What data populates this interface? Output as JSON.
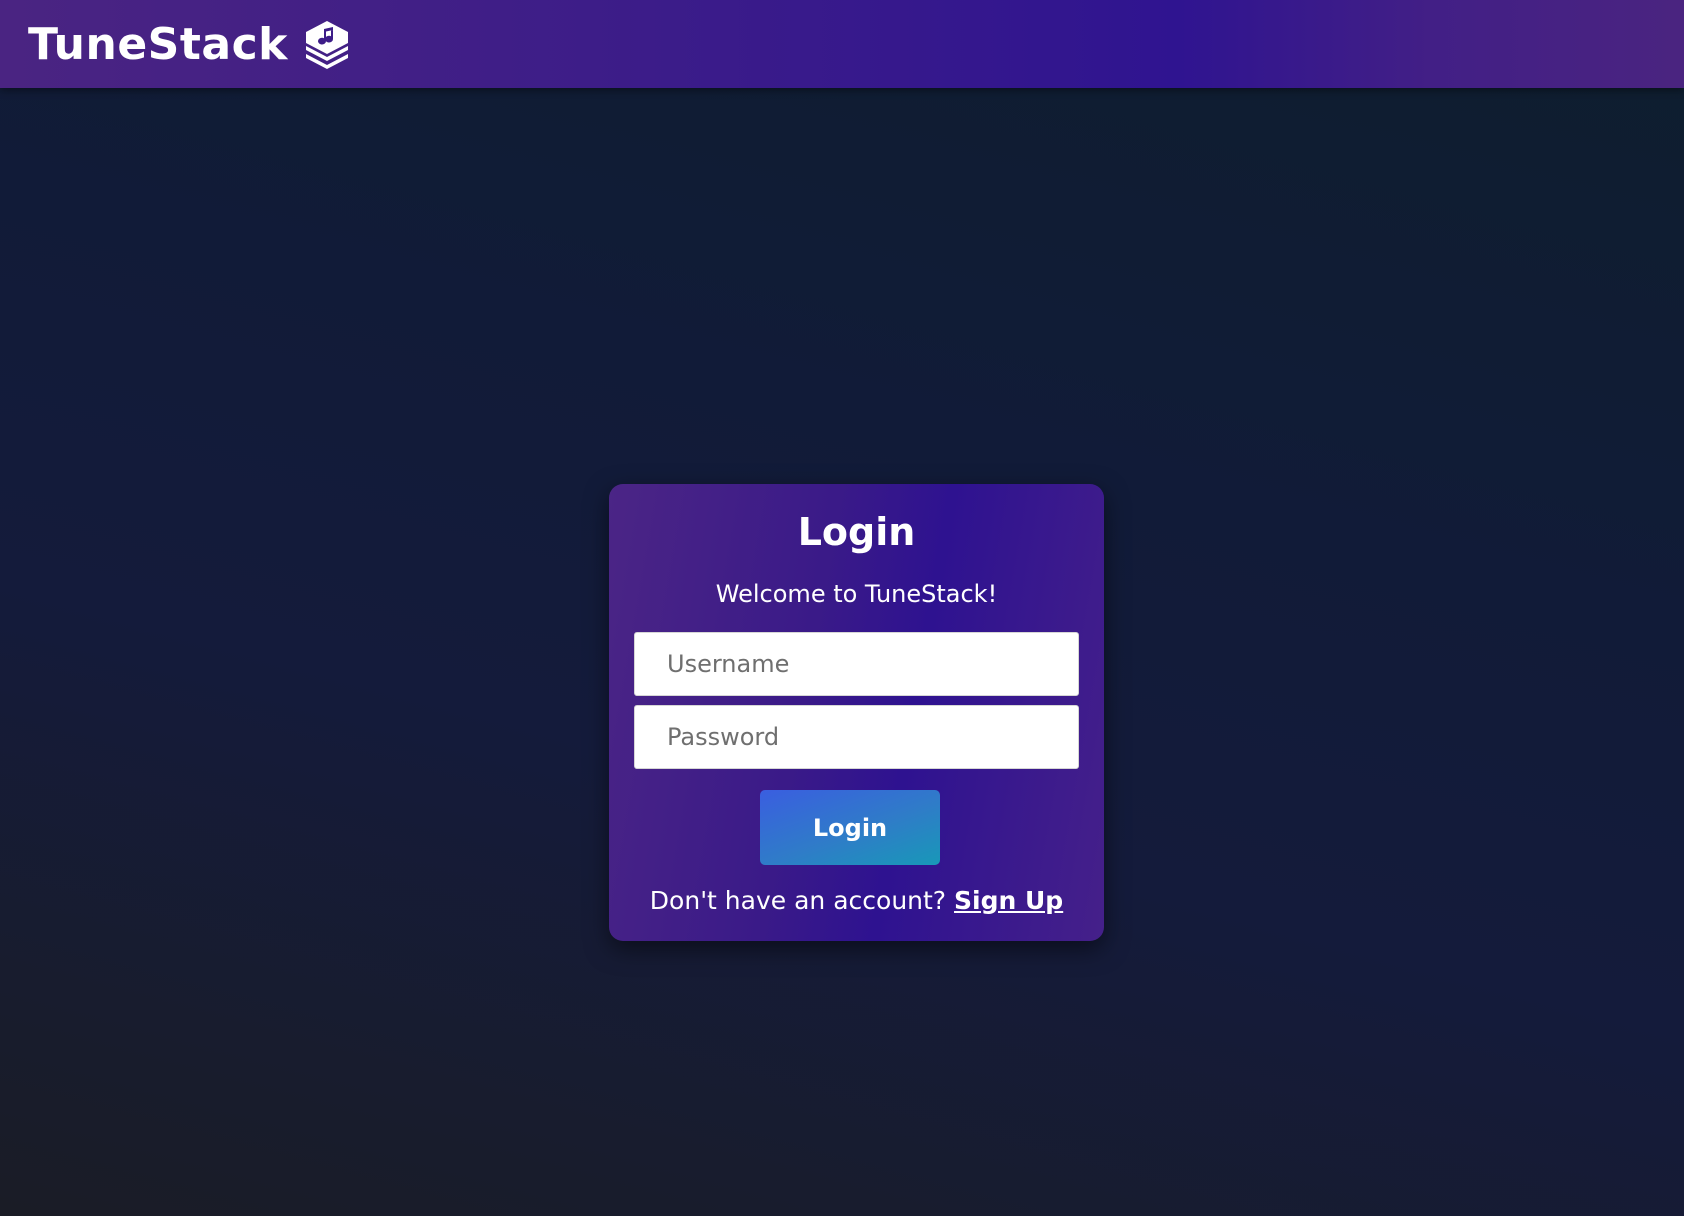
{
  "navbar": {
    "brand_title": "TuneStack",
    "brand_icon": "stacked-music-note-icon"
  },
  "login_card": {
    "title": "Login",
    "subtitle": "Welcome to TuneStack!",
    "username_placeholder": "Username",
    "username_value": "",
    "password_placeholder": "Password",
    "password_value": "",
    "login_button_label": "Login",
    "signup_prompt": "Don't have an account?",
    "signup_link_label": "Sign Up"
  },
  "colors": {
    "navbar_bg": "#3d1d88",
    "card_bg": "#3a1a88",
    "page_bg": "#111b38",
    "button_start": "#3a5ee0",
    "button_end": "#1898b8"
  }
}
